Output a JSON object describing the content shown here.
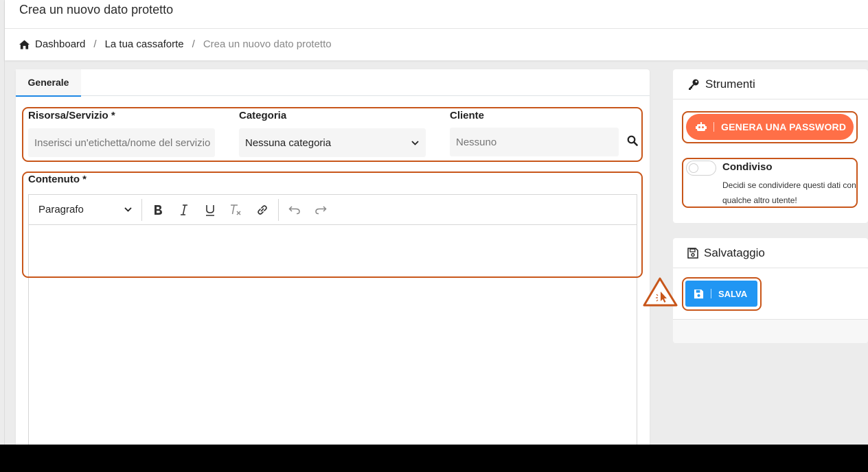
{
  "header": {
    "title": "Crea un nuovo dato protetto",
    "breadcrumb": {
      "home": "Dashboard",
      "separator": "/",
      "middle": "La tua cassaforte",
      "current": "Crea un nuovo dato protetto"
    }
  },
  "tabs": [
    {
      "label": "Generale",
      "active": true
    }
  ],
  "form": {
    "resource": {
      "label": "Risorsa/Servizio *",
      "placeholder": "Inserisci un'etichetta/nome del servizio"
    },
    "category": {
      "label": "Categoria",
      "selected": "Nessuna categoria"
    },
    "client": {
      "label": "Cliente",
      "placeholder": "Nessuno"
    },
    "content": {
      "label": "Contenuto *"
    }
  },
  "editor": {
    "paragraph_style": "Paragrafo",
    "buttons": [
      "bold",
      "italic",
      "underline",
      "clear-format",
      "link",
      "undo",
      "redo"
    ]
  },
  "tools": {
    "title": "Strumenti",
    "generate_label": "GENERA UNA PASSWORD",
    "shared_title": "Condiviso",
    "shared_desc": "Decidi se condividere questi dati con qualche altro utente!",
    "shared_on": false
  },
  "save": {
    "title": "Salvataggio",
    "save_label": "SALVA"
  },
  "colors": {
    "accent_orange": "#ff6f47",
    "primary_blue": "#2196f3",
    "highlight": "#c8561a"
  }
}
